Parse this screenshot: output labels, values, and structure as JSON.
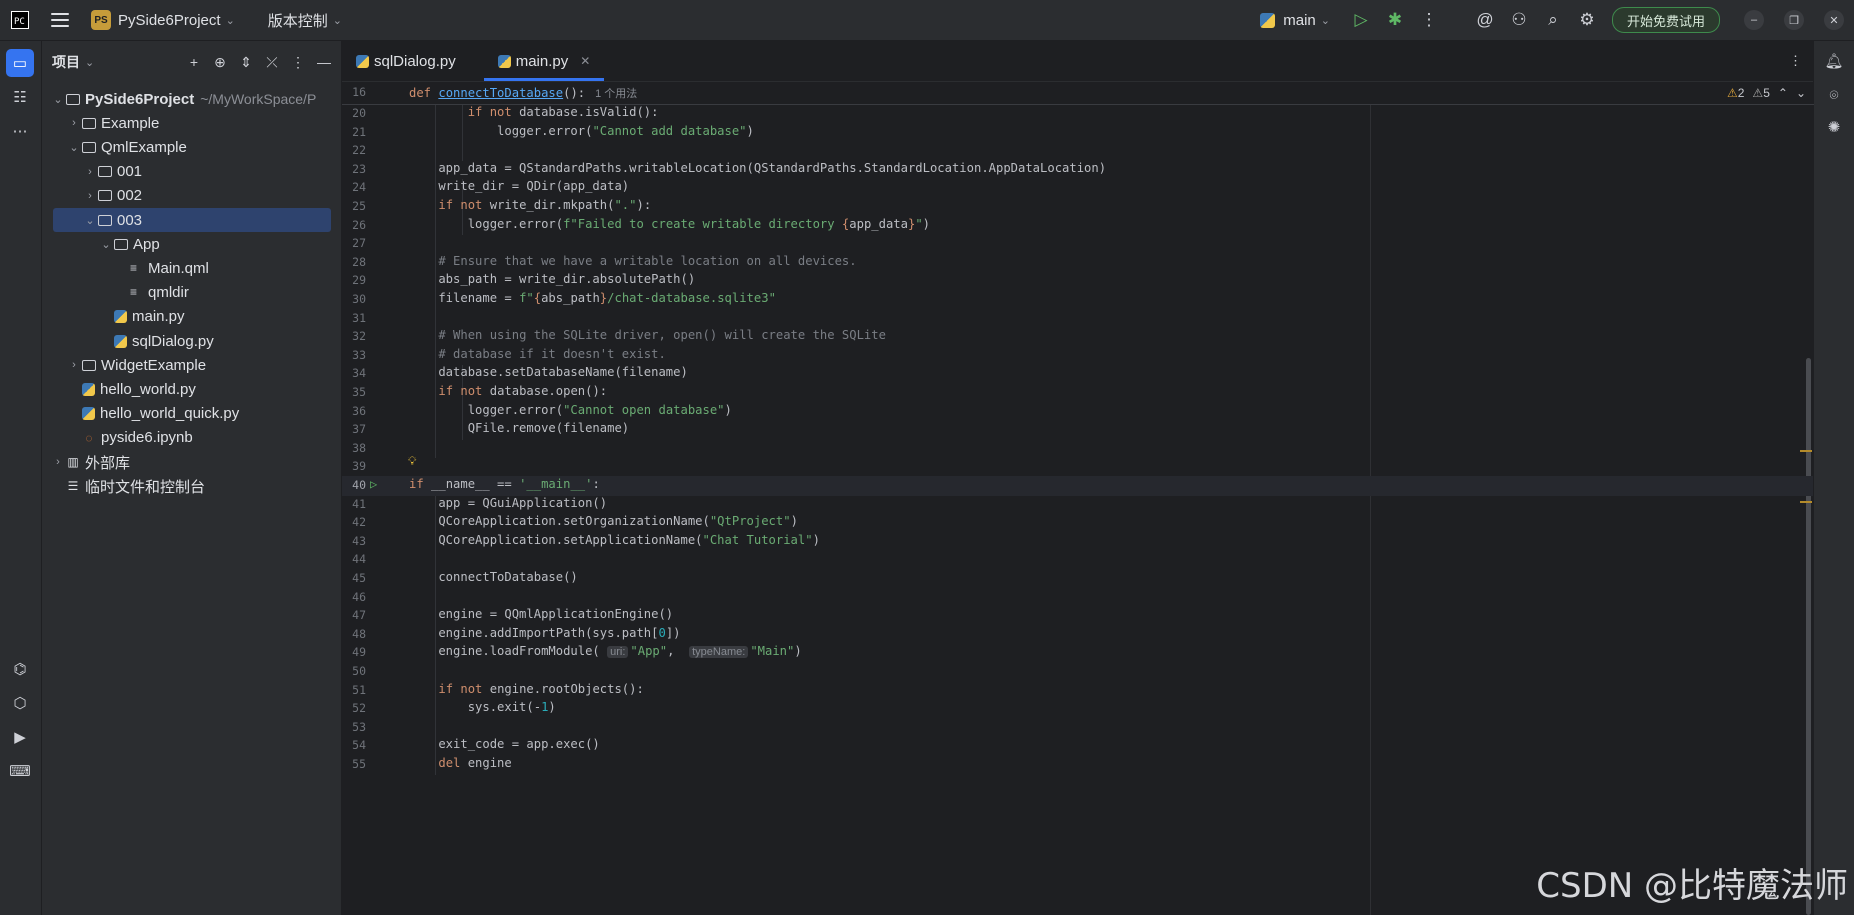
{
  "titlebar": {
    "logo_text": "PC",
    "project_badge": "PS",
    "project_name": "PySide6Project",
    "vcs_label": "版本控制",
    "branch": "main",
    "trial_button": "开始免费试用"
  },
  "project_panel": {
    "title": "项目",
    "tree": [
      {
        "label": "PySide6Project",
        "path": "~/MyWorkSpace/P",
        "type": "folder",
        "expanded": true,
        "level": 0
      },
      {
        "label": "Example",
        "type": "folder",
        "expanded": false,
        "level": 1
      },
      {
        "label": "QmlExample",
        "type": "folder",
        "expanded": true,
        "level": 1
      },
      {
        "label": "001",
        "type": "folder",
        "expanded": false,
        "level": 2
      },
      {
        "label": "002",
        "type": "folder",
        "expanded": false,
        "level": 2
      },
      {
        "label": "003",
        "type": "folder",
        "expanded": true,
        "level": 2,
        "selected": true
      },
      {
        "label": "App",
        "type": "folder",
        "expanded": true,
        "level": 3
      },
      {
        "label": "Main.qml",
        "type": "text",
        "level": 4
      },
      {
        "label": "qmldir",
        "type": "text",
        "level": 4
      },
      {
        "label": "main.py",
        "type": "python",
        "level": 3
      },
      {
        "label": "sqlDialog.py",
        "type": "python",
        "level": 3
      },
      {
        "label": "WidgetExample",
        "type": "folder",
        "expanded": false,
        "level": 1
      },
      {
        "label": "hello_world.py",
        "type": "python",
        "level": 1
      },
      {
        "label": "hello_world_quick.py",
        "type": "python",
        "level": 1
      },
      {
        "label": "pyside6.ipynb",
        "type": "notebook",
        "level": 1
      },
      {
        "label": "外部库",
        "type": "library",
        "expanded": false,
        "level": 0
      },
      {
        "label": "临时文件和控制台",
        "type": "scratch",
        "level": 0
      }
    ]
  },
  "editor": {
    "tabs": [
      {
        "label": "sqlDialog.py",
        "active": false
      },
      {
        "label": "main.py",
        "active": true
      }
    ],
    "sticky": {
      "line": "16",
      "usage": "1 个用法"
    },
    "warnings": {
      "warn_count": "2",
      "weak_count": "5"
    },
    "lines": [
      {
        "n": "20",
        "html": "        <span class=\"kw\">if not</span> database.isValid():"
      },
      {
        "n": "21",
        "html": "            logger.error(<span class=\"str\">\"Cannot add database\"</span>)"
      },
      {
        "n": "22",
        "html": ""
      },
      {
        "n": "23",
        "html": "    app_data = QStandardPaths.writableLocation(QStandardPaths.StandardLocation.AppDataLocation)"
      },
      {
        "n": "24",
        "html": "    write_dir = QDir(app_data)"
      },
      {
        "n": "25",
        "html": "    <span class=\"kw\">if not</span> write_dir.mkpath(<span class=\"str\">\".\"</span>):"
      },
      {
        "n": "26",
        "html": "        logger.error(<span class=\"str\">f\"Failed to create writable directory </span><span class=\"kw\">{</span>app_data<span class=\"kw\">}</span><span class=\"str\">\"</span>)"
      },
      {
        "n": "27",
        "html": ""
      },
      {
        "n": "28",
        "html": "    <span class=\"cm\"># Ensure that we have a writable location on all devices.</span>"
      },
      {
        "n": "29",
        "html": "    abs_path = write_dir.absolutePath()"
      },
      {
        "n": "30",
        "html": "    filename = <span class=\"str\">f\"</span><span class=\"kw\">{</span>abs_path<span class=\"kw\">}</span><span class=\"str\">/chat-database.sqlite3\"</span>"
      },
      {
        "n": "31",
        "html": ""
      },
      {
        "n": "32",
        "html": "    <span class=\"cm\"># When using the SQLite driver, open() will create the SQLite</span>"
      },
      {
        "n": "33",
        "html": "    <span class=\"cm\"># database if it doesn't exist.</span>"
      },
      {
        "n": "34",
        "html": "    database.setDatabaseName(filename)"
      },
      {
        "n": "35",
        "html": "    <span class=\"kw\">if not</span> database.open():"
      },
      {
        "n": "36",
        "html": "        logger.error(<span class=\"str\">\"Cannot open database\"</span>)"
      },
      {
        "n": "37",
        "html": "        QFile.remove(filename)"
      },
      {
        "n": "38",
        "html": ""
      },
      {
        "n": "39",
        "html": ""
      },
      {
        "n": "40",
        "html": "<span class=\"kw\">if</span> __name__ == <span class=\"str\">'__main__'</span>:"
      },
      {
        "n": "41",
        "html": "    app = QGuiApplication()"
      },
      {
        "n": "42",
        "html": "    QCoreApplication.setOrganizationName(<span class=\"str\">\"QtProject\"</span>)"
      },
      {
        "n": "43",
        "html": "    QCoreApplication.setApplicationName(<span class=\"str\">\"Chat Tutorial\"</span>)"
      },
      {
        "n": "44",
        "html": ""
      },
      {
        "n": "45",
        "html": "    connectToDatabase()"
      },
      {
        "n": "46",
        "html": ""
      },
      {
        "n": "47",
        "html": "    engine = QQmlApplicationEngine()"
      },
      {
        "n": "48",
        "html": "    engine.addImportPath(sys.path[<span class=\"num\">0</span>])"
      },
      {
        "n": "49",
        "html": "    engine.loadFromModule( <span class=\"hint\">uri:</span><span class=\"str\">\"App\"</span>,  <span class=\"hint\">typeName:</span><span class=\"str\">\"Main\"</span>)"
      },
      {
        "n": "50",
        "html": ""
      },
      {
        "n": "51",
        "html": "    <span class=\"kw\">if not</span> engine.rootObjects():"
      },
      {
        "n": "52",
        "html": "        sys.exit(-<span class=\"num\">1</span>)"
      },
      {
        "n": "53",
        "html": ""
      },
      {
        "n": "54",
        "html": "    exit_code = app.exec()"
      },
      {
        "n": "55",
        "html": "    <span class=\"kw\">del</span> engine"
      }
    ]
  },
  "watermark": "CSDN @比特魔法师"
}
